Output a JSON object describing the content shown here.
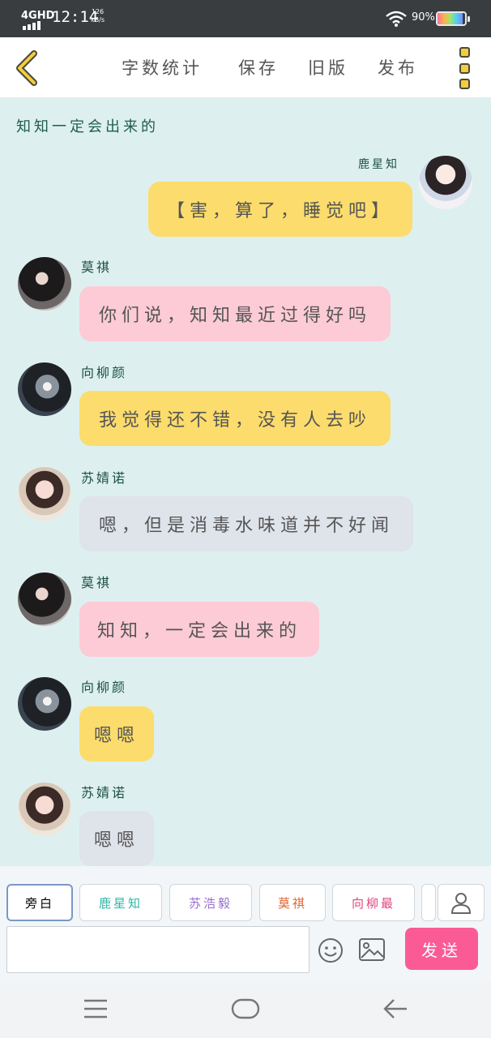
{
  "status_bar": {
    "network": "4GHD",
    "time": "12:14",
    "speed_value": "126",
    "speed_unit": "kB/s",
    "battery": "90%",
    "icons": [
      "signal-icon",
      "wifi-icon",
      "battery-icon"
    ]
  },
  "toolbar": {
    "back_icon": "chevron-left-icon",
    "word_count_label": "字数统计",
    "save_label": "保存",
    "old_version_label": "旧版",
    "publish_label": "发布",
    "menu_icon": "more-icon"
  },
  "chat": {
    "narration": "知知一定会出来的",
    "messages": [
      {
        "sender": "鹿星知",
        "text": "【害，算了，睡觉吧】",
        "side": "right",
        "bubble_color": "#fcdc6c",
        "avatar": "avatar-lu-xingzhi"
      },
      {
        "sender": "莫祺",
        "text": "你们说，知知最近过得好吗",
        "side": "left",
        "bubble_color": "#fccbd6",
        "avatar": "avatar-mo-qi"
      },
      {
        "sender": "向柳颜",
        "text": "我觉得还不错，没有人去吵",
        "side": "left",
        "bubble_color": "#fcdc6c",
        "avatar": "avatar-xiang-liuyan"
      },
      {
        "sender": "苏婧诺",
        "text": "嗯，但是消毒水味道并不好闻",
        "side": "left",
        "bubble_color": "#dfe3ea",
        "avatar": "avatar-su-jingnuo"
      },
      {
        "sender": "莫祺",
        "text": "知知，一定会出来的",
        "side": "left",
        "bubble_color": "#fccbd6",
        "avatar": "avatar-mo-qi"
      },
      {
        "sender": "向柳颜",
        "text": "嗯嗯",
        "side": "left",
        "bubble_color": "#fcdc6c",
        "avatar": "avatar-xiang-liuyan"
      },
      {
        "sender": "苏婧诺",
        "text": "嗯嗯",
        "side": "left",
        "bubble_color": "#dfe3ea",
        "avatar": "avatar-su-jingnuo"
      }
    ]
  },
  "input_panel": {
    "role_tabs": [
      {
        "label": "旁白",
        "color": "#555555",
        "active": true
      },
      {
        "label": "鹿星知",
        "color": "#2fb7a8",
        "active": false
      },
      {
        "label": "苏浩毅",
        "color": "#9a6fd0",
        "active": false
      },
      {
        "label": "莫祺",
        "color": "#e0622f",
        "active": false
      },
      {
        "label": "向柳最",
        "color": "#e0467f",
        "active": false
      }
    ],
    "contact_icon": "person-icon",
    "message_value": "",
    "emoji_icon": "emoji-icon",
    "image_icon": "image-icon",
    "send_label": "发送"
  },
  "nav_bar": {
    "icons": [
      "menu-icon",
      "home-icon",
      "back-icon"
    ]
  }
}
